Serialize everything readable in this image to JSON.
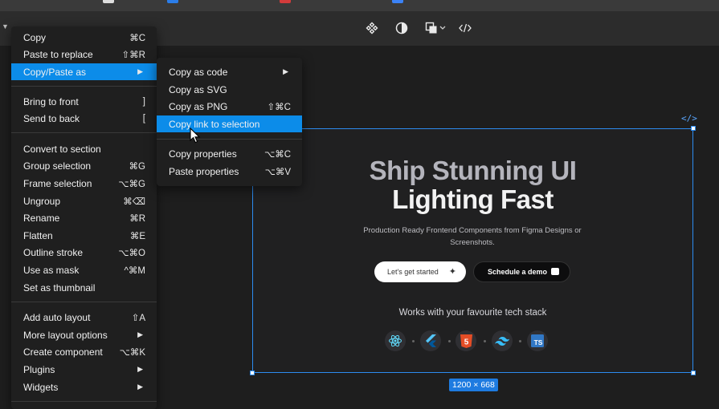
{
  "colors": {
    "accent": "#0c8ce9",
    "selection": "#2d8cf0",
    "menu_bg": "#1f1f1f",
    "canvas_bg": "#1e1e1e"
  },
  "toolbar": {
    "icons": [
      "component-icon",
      "contrast-icon",
      "boolean-ops-icon",
      "dropdown-chevron-icon",
      "code-icon"
    ]
  },
  "main_menu": {
    "items": [
      {
        "label": "Copy",
        "shortcut": "⌘C"
      },
      {
        "label": "Paste to replace",
        "shortcut": "⇧⌘R"
      },
      {
        "label": "Copy/Paste as",
        "submenu": true,
        "highlighted": true
      },
      {
        "label": "Bring to front",
        "shortcut": "]"
      },
      {
        "label": "Send to back",
        "shortcut": "["
      },
      {
        "label": "Convert to section"
      },
      {
        "label": "Group selection",
        "shortcut": "⌘G"
      },
      {
        "label": "Frame selection",
        "shortcut": "⌥⌘G"
      },
      {
        "label": "Ungroup",
        "shortcut": "⌘⌫"
      },
      {
        "label": "Rename",
        "shortcut": "⌘R"
      },
      {
        "label": "Flatten",
        "shortcut": "⌘E"
      },
      {
        "label": "Outline stroke",
        "shortcut": "⌥⌘O"
      },
      {
        "label": "Use as mask",
        "shortcut": "^⌘M"
      },
      {
        "label": "Set as thumbnail"
      },
      {
        "label": "Add auto layout",
        "shortcut": "⇧A"
      },
      {
        "label": "More layout options",
        "submenu": true
      },
      {
        "label": "Create component",
        "shortcut": "⌥⌘K"
      },
      {
        "label": "Plugins",
        "submenu": true
      },
      {
        "label": "Widgets",
        "submenu": true
      }
    ]
  },
  "sub_menu": {
    "items": [
      {
        "label": "Copy as code",
        "submenu": true
      },
      {
        "label": "Copy as SVG"
      },
      {
        "label": "Copy as PNG",
        "shortcut": "⇧⌘C"
      },
      {
        "label": "Copy link to selection",
        "highlighted": true
      },
      {
        "label": "Copy properties",
        "shortcut": "⌥⌘C"
      },
      {
        "label": "Paste properties",
        "shortcut": "⌥⌘V"
      }
    ]
  },
  "frame": {
    "code_tag": "</>",
    "size_badge": "1200 × 668",
    "title_line1": "Ship Stunning UI",
    "title_line2": "Lighting Fast",
    "subtitle": "Production Ready Frontend Components from Figma Designs or Screenshots.",
    "primary_button": "Let's get started",
    "secondary_button": "Schedule a demo",
    "tech_heading": "Works with your favourite tech stack",
    "tech_icons": [
      "react-icon",
      "flutter-icon",
      "html5-icon",
      "tailwind-icon",
      "typescript-icon"
    ],
    "ts_label": "TS",
    "html5_label": "5"
  }
}
